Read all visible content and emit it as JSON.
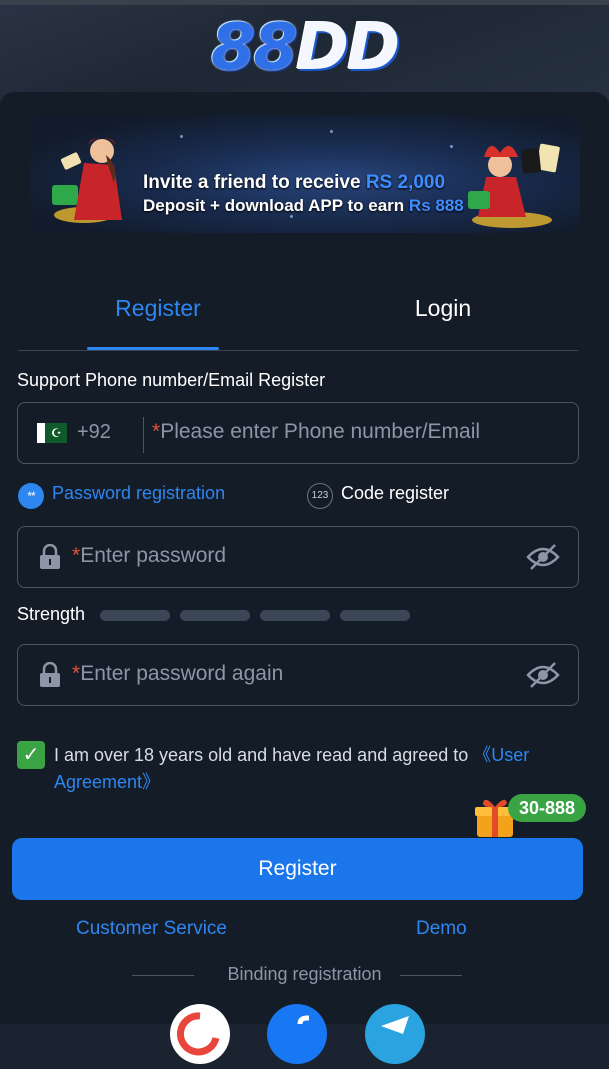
{
  "brand": {
    "logo_num": "88",
    "logo_letters": "DD"
  },
  "banner": {
    "line1_text": "Invite a friend to receive",
    "line1_amount": "RS 2,000",
    "line2_text": "Deposit + download APP to earn",
    "line2_amount": "Rs 888"
  },
  "tabs": {
    "register": "Register",
    "login": "Login",
    "active": "Register"
  },
  "phone": {
    "section_label": "Support Phone number/Email Register",
    "country_code": "+92",
    "required_mark": "*",
    "placeholder": "Please enter Phone number/Email"
  },
  "methods": {
    "password_icon": "**",
    "password_label": "Password registration",
    "code_icon": "123",
    "code_label": "Code register",
    "selected": "password"
  },
  "password": {
    "required_mark": "*",
    "placeholder": "Enter password"
  },
  "strength": {
    "label": "Strength",
    "level": 0,
    "segments": 4
  },
  "confirm": {
    "required_mark": "*",
    "placeholder": "Enter password again"
  },
  "agreement": {
    "checked": true,
    "text": "I am over 18 years old and have read and agreed to ",
    "link_line1": "《User",
    "link_line2": "Agreement》"
  },
  "promo": {
    "badge": "30-888"
  },
  "actions": {
    "register_button": "Register"
  },
  "footer": {
    "customer_service": "Customer Service",
    "demo": "Demo",
    "binding_label": "Binding registration"
  },
  "colors": {
    "accent": "#2e86f0",
    "button": "#1a76ea",
    "success": "#3aa344",
    "background": "#141c28",
    "required": "#e0533b"
  },
  "icons": [
    "logo",
    "pakistan-flag-icon",
    "lock-icon",
    "eye-off-icon",
    "check-icon",
    "gift-icon",
    "google-icon",
    "facebook-icon",
    "telegram-icon"
  ]
}
